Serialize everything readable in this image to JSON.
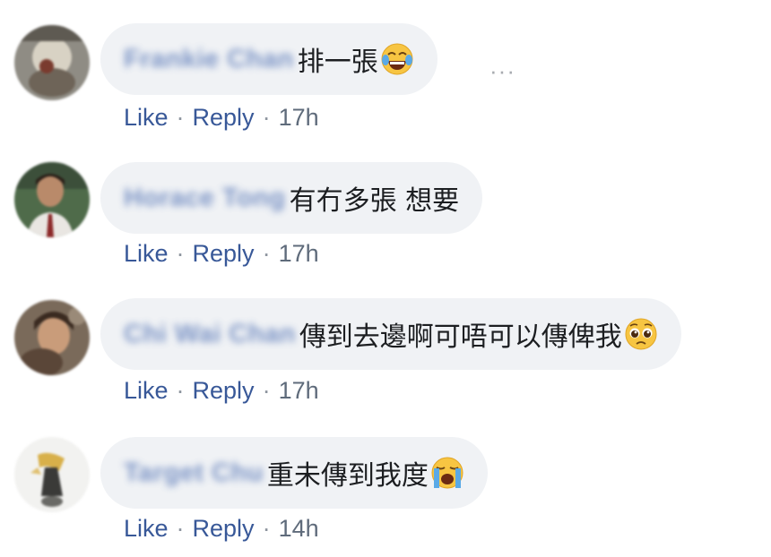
{
  "comments": [
    {
      "author": "Frankie Chan",
      "text": "排一張",
      "emoji": "tears-of-joy-emoji",
      "like": "Like",
      "reply": "Reply",
      "time": "17h",
      "more_options": "···"
    },
    {
      "author": "Horace Tong",
      "text": "有冇多張 想要",
      "like": "Like",
      "reply": "Reply",
      "time": "17h"
    },
    {
      "author": "Chi Wai Chan",
      "text": "傳到去邊啊可唔可以傳俾我",
      "emoji": "pleading-face-emoji",
      "like": "Like",
      "reply": "Reply",
      "time": "17h"
    },
    {
      "author": "Target Chu",
      "text": "重未傳到我度",
      "emoji": "loudly-crying-face-emoji",
      "like": "Like",
      "reply": "Reply",
      "time": "14h"
    }
  ],
  "separator": "·",
  "colors": {
    "bubble": "#f0f2f5",
    "link": "#385898",
    "meta": "#5f6b7b",
    "text": "#1c1e21"
  }
}
